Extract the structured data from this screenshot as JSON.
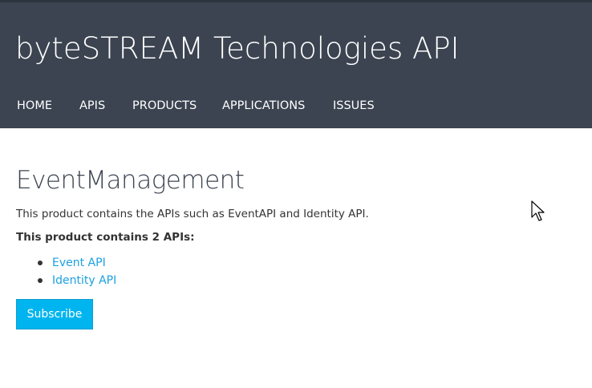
{
  "header": {
    "title": "byteSTREAM Technologies API",
    "nav": [
      {
        "label": "HOME"
      },
      {
        "label": "APIS"
      },
      {
        "label": "PRODUCTS"
      },
      {
        "label": "APPLICATIONS"
      },
      {
        "label": "ISSUES"
      }
    ]
  },
  "product": {
    "name": "EventManagement",
    "description": "This product contains the APIs such as EventAPI and Identity API.",
    "api_count_text": "This product contains 2 APIs:",
    "apis": [
      {
        "label": "Event API"
      },
      {
        "label": "Identity API"
      }
    ],
    "subscribe_label": "Subscribe"
  },
  "colors": {
    "header_bg": "#3c4451",
    "link": "#1ba1e2",
    "button_bg": "#00b5ef"
  },
  "icons": {
    "cursor": "mouse-pointer-icon"
  }
}
